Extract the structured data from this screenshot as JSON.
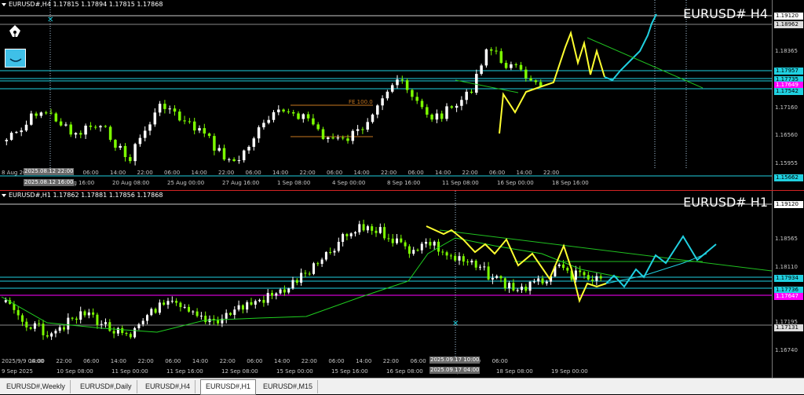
{
  "tabs": [
    "EURUSD#,Weekly",
    "EURUSD#,Daily",
    "EURUSD#,H4",
    "EURUSD#,H1",
    "EURUSD#,M15"
  ],
  "active_tab": 3,
  "h4": {
    "header": "EURUSD#,H4  1.17815 1.17894 1.17815 1.17868",
    "symbol_label": "EURUSD# H4",
    "fe_label": "FE 100.0",
    "price_labels": [
      "1.18365",
      "1.17160",
      "1.16560",
      "1.15955"
    ],
    "price_boxes": [
      {
        "text": "1.19120",
        "bg": "#ffffff",
        "fg": "#000000"
      },
      {
        "text": "1.18962",
        "bg": "#dddddd",
        "fg": "#000000"
      },
      {
        "text": "1.17957",
        "bg": "#20d0e0",
        "fg": "#000000"
      },
      {
        "text": "1.17735",
        "bg": "#20d0e0",
        "fg": "#000000"
      },
      {
        "text": "1.17649",
        "bg": "#ff00ff",
        "fg": "#ffffff"
      },
      {
        "text": "1.17542",
        "bg": "#20d0e0",
        "fg": "#000000"
      },
      {
        "text": "1.15662",
        "bg": "#20d0e0",
        "fg": "#000000"
      }
    ],
    "time_labels": [
      "8 Aug 2025",
      "14:00",
      "22:00",
      "06:00",
      "14:00",
      "22:00",
      "06:00",
      "14:00",
      "22:00",
      "06:00",
      "14:00",
      "22:00",
      "06:00",
      "14:00",
      "22:00",
      "06:00",
      "14:00",
      "22:00",
      "06:00",
      "14:00",
      "22:00"
    ],
    "time_labels2": [
      "15 Aug 16:00",
      "20 Aug 08:00",
      "25 Aug 00:00",
      "27 Aug 16:00",
      "1 Sep 08:00",
      "4 Sep 00:00",
      "8 Sep 16:00",
      "11 Sep 08:00",
      "16 Sep 00:00",
      "18 Sep 16:00"
    ],
    "cursor_time_a": "2025.08.12 22:00",
    "cursor_time_b": "2025.08.12 16:00"
  },
  "h1": {
    "header": "EURUSD#,H1  1.17862 1.17881 1.17856 1.17868",
    "symbol_label": "EURUSD# H1",
    "price_labels": [
      "1.18565",
      "1.18110",
      "1.17195",
      "1.16740"
    ],
    "price_boxes": [
      {
        "text": "1.19120",
        "bg": "#ffffff",
        "fg": "#000000"
      },
      {
        "text": "1.17934",
        "bg": "#20d0e0",
        "fg": "#000000"
      },
      {
        "text": "1.17736",
        "bg": "#20d0e0",
        "fg": "#000000"
      },
      {
        "text": "1.17647",
        "bg": "#ff00ff",
        "fg": "#ffffff"
      },
      {
        "text": "1.17131",
        "bg": "#dddddd",
        "fg": "#000000"
      }
    ],
    "time_labels": [
      "2025/9/9 06:00",
      "14:00",
      "22:00",
      "06:00",
      "14:00",
      "22:00",
      "06:00",
      "14:00",
      "22:00",
      "06:00",
      "14:00",
      "22:00",
      "06:00",
      "14:00",
      "22:00",
      "06:00",
      "14:00",
      "22:00",
      "06:00"
    ],
    "time_labels2": [
      "9 Sep 2025",
      "10 Sep 08:00",
      "11 Sep 00:00",
      "11 Sep 16:00",
      "12 Sep 08:00",
      "15 Sep 00:00",
      "15 Sep 16:00",
      "16 Sep 08:00",
      "17 Sep 16:00",
      "18 Sep 08:00",
      "19 Sep 00:00"
    ],
    "cursor_time_a": "2025.09.17 10:00",
    "cursor_time_b": "2025.09.17 04:00"
  },
  "colors": {
    "bull": "#ffffff",
    "bear": "#7cfc00",
    "yellow": "#ffff30",
    "cyan": "#20d0e0",
    "ma": "#20d020",
    "magenta": "#ff00ff",
    "fe": "#c87820"
  }
}
